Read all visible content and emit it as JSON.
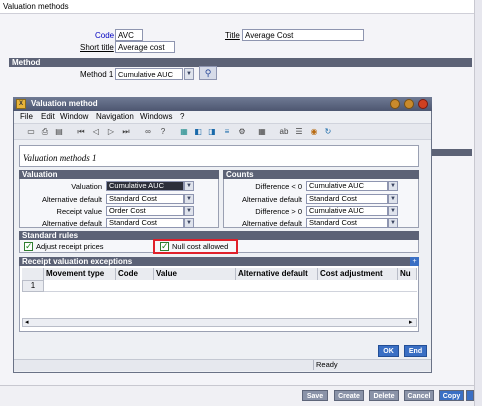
{
  "window_title": "Valuation methods",
  "header": {
    "code_label": "Code",
    "code_value": "AVC",
    "title_label": "Title",
    "title_value": "Average Cost",
    "short_title_label": "Short title",
    "short_title_value": "Average cost"
  },
  "method_section": {
    "header": "Method",
    "method1_label": "Method 1",
    "method1_value": "Cumulative AUC"
  },
  "dialog": {
    "title": "Valuation method",
    "menu": [
      "File",
      "Edit",
      "Window",
      "Navigation",
      "Windows",
      "?"
    ],
    "caption": "Valuation methods 1",
    "valuation": {
      "header": "Valuation",
      "rows": [
        {
          "label": "Valuation",
          "value": "Cumulative AUC"
        },
        {
          "label": "Alternative default",
          "value": "Standard Cost"
        },
        {
          "label": "Receipt value",
          "value": "Order Cost"
        },
        {
          "label": "Alternative default",
          "value": "Standard Cost"
        }
      ]
    },
    "counts": {
      "header": "Counts",
      "rows": [
        {
          "label": "Difference < 0",
          "value": "Cumulative AUC"
        },
        {
          "label": "Alternative default",
          "value": "Standard Cost"
        },
        {
          "label": "Difference > 0",
          "value": "Cumulative AUC"
        },
        {
          "label": "Alternative default",
          "value": "Standard Cost"
        }
      ]
    },
    "standard_rules": {
      "header": "Standard rules",
      "adjust_receipt_prices": "Adjust receipt prices",
      "null_cost_allowed": "Null cost allowed"
    },
    "exceptions": {
      "header": "Receipt valuation exceptions",
      "columns": [
        "Movement type",
        "Code",
        "Value",
        "Alternative default",
        "Cost adjustment",
        "Nu"
      ],
      "row_number": "1"
    },
    "ok_label": "OK",
    "end_label": "End",
    "status": "Ready"
  },
  "bottom_buttons": [
    "Save",
    "Create",
    "Delete",
    "Cancel",
    "Copy"
  ],
  "colors": {
    "section_header": "#5c6276",
    "highlight_box": "#e0202a",
    "active_button": "#3a6fc4"
  }
}
